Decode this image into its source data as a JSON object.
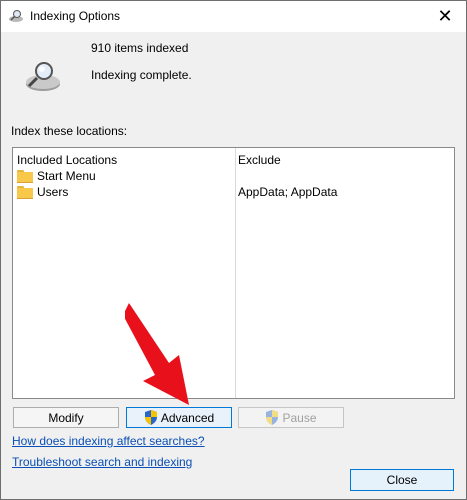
{
  "window": {
    "title": "Indexing Options",
    "close_glyph": "✕"
  },
  "status": {
    "count_text": "910 items indexed",
    "state_text": "Indexing complete."
  },
  "section_label": "Index these locations:",
  "locations": {
    "headers": {
      "included": "Included Locations",
      "exclude": "Exclude"
    },
    "rows": [
      {
        "name": "Start Menu",
        "exclude": ""
      },
      {
        "name": "Users",
        "exclude": "AppData; AppData"
      }
    ]
  },
  "buttons": {
    "modify": "Modify",
    "advanced": "Advanced",
    "pause": "Pause",
    "close": "Close"
  },
  "links": {
    "how": "How does indexing affect searches?",
    "troubleshoot": "Troubleshoot search and indexing"
  },
  "colors": {
    "accent": "#0078d7",
    "arrow": "#e8101a",
    "link": "#0a4fb5"
  },
  "icons": [
    "indexing-options-icon",
    "close-icon",
    "indexing-status-icon",
    "folder-icon",
    "uac-shield-icon",
    "pointer-arrow"
  ]
}
